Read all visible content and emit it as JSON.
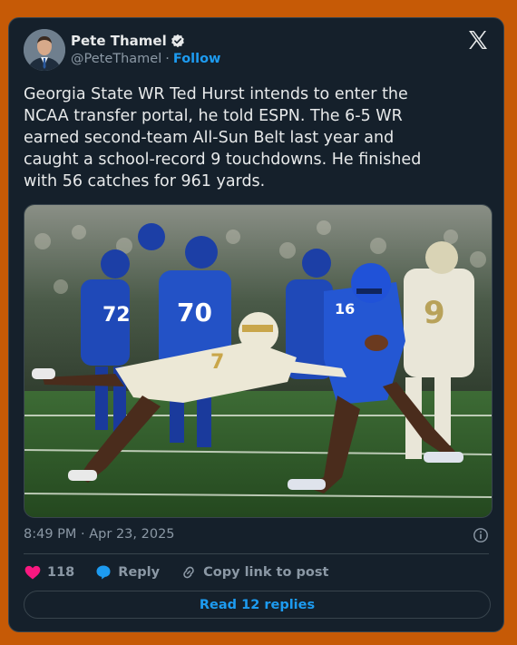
{
  "author": {
    "name": "Pete Thamel",
    "handle": "@PeteThamel",
    "separator": "·",
    "follow_label": "Follow"
  },
  "tweet": {
    "text": "Georgia State WR Ted Hurst intends to enter the\nNCAA transfer portal, he told ESPN. The 6-5 WR\nearned second-team All-Sun Belt last year and\ncaught a school-record 9 touchdowns. He finished\nwith 56 catches for 961 yards."
  },
  "media": {
    "jersey_numbers": [
      "72",
      "70",
      "16",
      "9",
      "7"
    ]
  },
  "meta": {
    "timestamp": "8:49 PM · Apr 23, 2025"
  },
  "actions": {
    "likes": "118",
    "reply_label": "Reply",
    "copy_label": "Copy link to post"
  },
  "replies_button": "Read 12 replies",
  "colors": {
    "background": "#c65a06",
    "card": "#15202b",
    "accent": "#1d9bf0",
    "like": "#f91880"
  }
}
